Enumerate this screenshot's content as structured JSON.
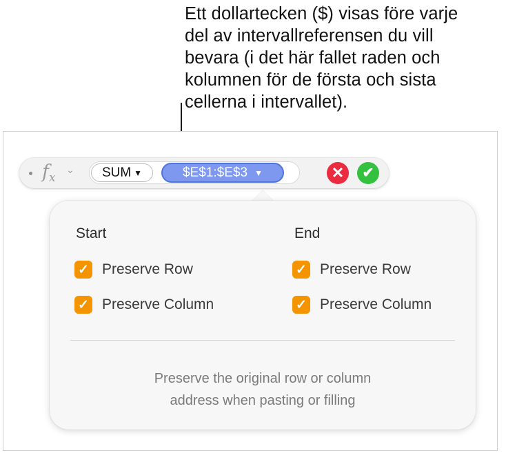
{
  "callout": {
    "text": "Ett dollartecken ($) visas före varje\ndel av intervallreferensen du vill\nbevara (i det här fallet raden och\nkolumnen för de första och sista\ncellerna i intervallet)."
  },
  "formula_bar": {
    "fx_icon": "fx-icon",
    "function_label": "SUM",
    "range_label": "$E$1:$E$3",
    "cancel_icon": "close-icon",
    "accept_icon": "checkmark-icon"
  },
  "popover": {
    "start": {
      "heading": "Start",
      "preserve_row": "Preserve Row",
      "preserve_column": "Preserve Column",
      "row_checked": true,
      "column_checked": true
    },
    "end": {
      "heading": "End",
      "preserve_row": "Preserve Row",
      "preserve_column": "Preserve Column",
      "row_checked": true,
      "column_checked": true
    },
    "note": "Preserve the original row or column\naddress when pasting or filling"
  },
  "colors": {
    "checkbox": "#f39400",
    "range_pill": "#7d98ee",
    "cancel": "#ea2b40",
    "accept": "#34c140"
  }
}
